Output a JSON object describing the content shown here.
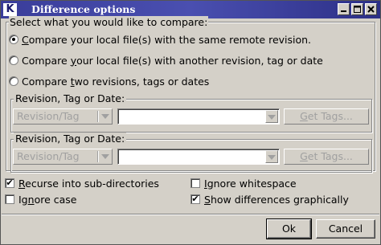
{
  "window": {
    "app_icon_letter": "K",
    "title": "Difference options"
  },
  "compare": {
    "section_label": "Select what you would like to compare:",
    "options": [
      {
        "label_pre": "",
        "mnemonic": "C",
        "label_post": "ompare your local file(s) with the same remote revision.",
        "selected": true
      },
      {
        "label_pre": "Compare ",
        "mnemonic": "y",
        "label_post": "our local file(s) with another revision, tag or date",
        "selected": false
      },
      {
        "label_pre": "Compare ",
        "mnemonic": "t",
        "label_post": "wo revisions, tags or dates",
        "selected": false
      }
    ]
  },
  "revision_groups": [
    {
      "title": "Revision, Tag or Date:",
      "type_value": "Revision/Tag",
      "text_value": "",
      "get_tags_pre": "",
      "get_tags_mnemonic": "G",
      "get_tags_post": "et Tags..."
    },
    {
      "title": "Revision, Tag or Date:",
      "type_value": "Revision/Tag",
      "text_value": "",
      "get_tags_pre": "",
      "get_tags_mnemonic": "G",
      "get_tags_post": "et Tags..."
    }
  ],
  "checkboxes": [
    {
      "label_pre": "",
      "mnemonic": "R",
      "label_post": "ecurse into sub-directories",
      "checked": true,
      "mark": "✔"
    },
    {
      "label_pre": "Ig",
      "mnemonic": "n",
      "label_post": "ore case",
      "checked": false,
      "mark": ""
    },
    {
      "label_pre": "",
      "mnemonic": "I",
      "label_post": "gnore whitespace",
      "checked": false,
      "mark": ""
    },
    {
      "label_pre": "",
      "mnemonic": "S",
      "label_post": "how differences graphically",
      "checked": true,
      "mark": "✔"
    }
  ],
  "buttons": {
    "ok": "Ok",
    "cancel": "Cancel"
  },
  "colors": {
    "titlebar": "#3a3d9a",
    "face": "#d4d0c8",
    "disabled_text": "#a0a0a0"
  }
}
